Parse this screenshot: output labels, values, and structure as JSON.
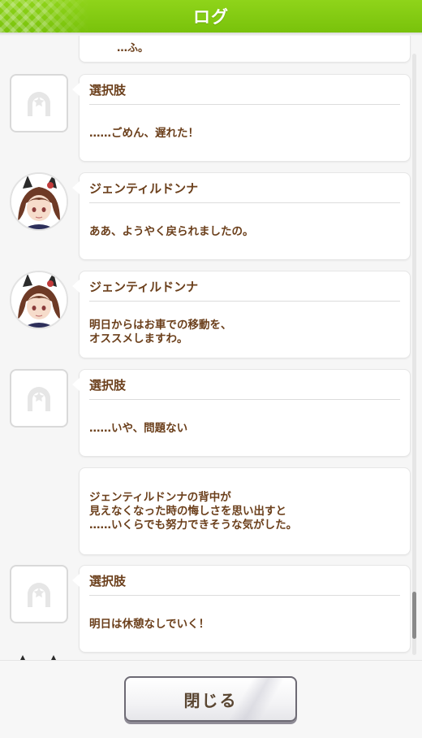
{
  "header": {
    "title": "ログ"
  },
  "log": {
    "entries": [
      {
        "type": "narration",
        "speaker": "",
        "text": "…ふ。"
      },
      {
        "type": "choice",
        "speaker": "選択肢",
        "text": "……ごめん、遅れた！"
      },
      {
        "type": "character",
        "speaker": "ジェンティルドンナ",
        "text": "ああ、ようやく戻られましたの。"
      },
      {
        "type": "character",
        "speaker": "ジェンティルドンナ",
        "text": "明日からはお車での移動を、\nオススメしますわ。"
      },
      {
        "type": "choice",
        "speaker": "選択肢",
        "text": "……いや、問題ない"
      },
      {
        "type": "narration",
        "speaker": "",
        "text": "ジェンティルドンナの背中が\n見えなくなった時の悔しさを思い出すと\n……いくらでも努力できそうな気がした。"
      },
      {
        "type": "choice",
        "speaker": "選択肢",
        "text": "明日は休憩なしでいく！"
      }
    ]
  },
  "footer": {
    "close_label": "閉じる"
  },
  "colors": {
    "header_green": "#7fc80f",
    "text_brown": "#6b3f1b",
    "hair": "#6e3a26"
  },
  "icons": {
    "choice_avatar": "horseshoe-icon",
    "character_avatar": "character-portrait"
  }
}
